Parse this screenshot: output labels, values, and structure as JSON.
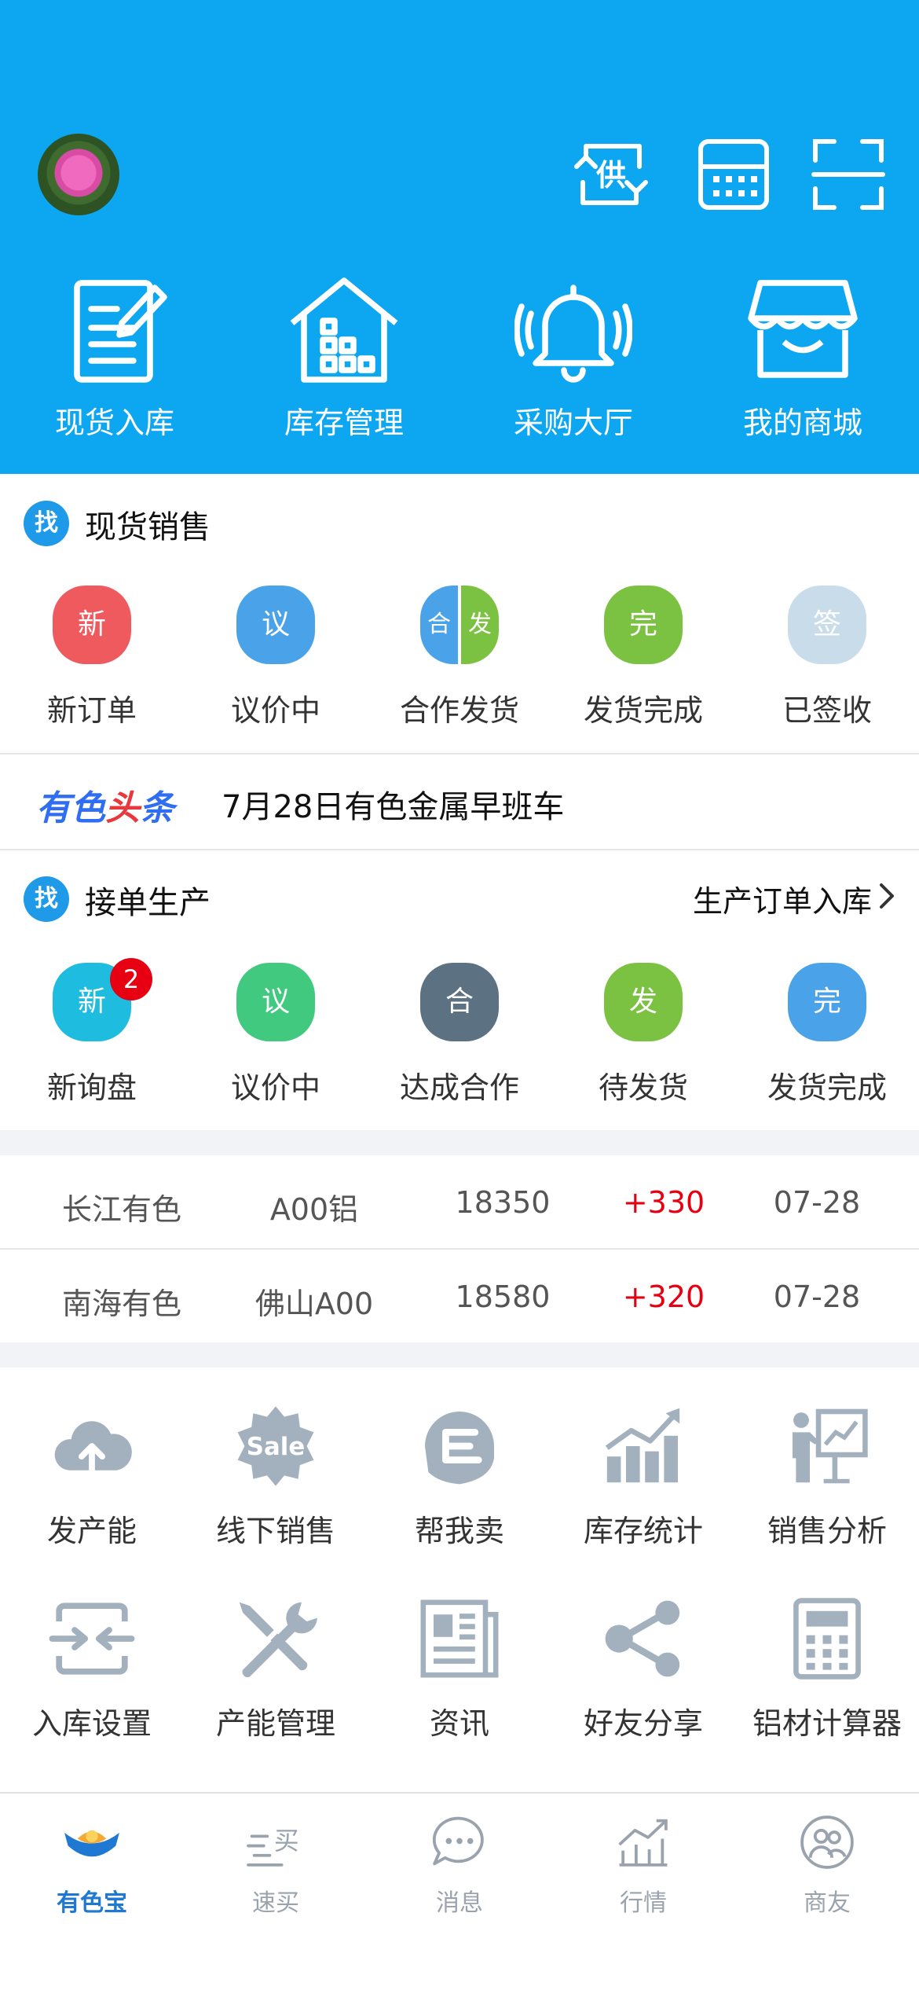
{
  "header": {
    "icons": [
      {
        "name": "supply-switch-icon",
        "text": "供"
      },
      {
        "name": "calculator-icon"
      },
      {
        "name": "scan-icon"
      }
    ],
    "nav": [
      {
        "label": "现货入库",
        "icon": "notepad-icon"
      },
      {
        "label": "库存管理",
        "icon": "warehouse-icon"
      },
      {
        "label": "采购大厅",
        "icon": "bell-icon"
      },
      {
        "label": "我的商城",
        "icon": "shop-icon"
      }
    ]
  },
  "spot_sales": {
    "badge": "找",
    "title": "现货销售",
    "items": [
      {
        "label": "新订单",
        "glyph": "新",
        "color": "#ef5a5f"
      },
      {
        "label": "议价中",
        "glyph": "议",
        "color": "#4aa3e8"
      },
      {
        "label": "合作发货",
        "glyph_left": "合",
        "glyph_right": "发",
        "color_left": "#4aa3e8",
        "color_right": "#7cc242"
      },
      {
        "label": "发货完成",
        "glyph": "完",
        "color": "#7cc242"
      },
      {
        "label": "已签收",
        "glyph": "签",
        "color": "#c9dcea"
      }
    ]
  },
  "news": {
    "logo_part1": "有色",
    "logo_part2": "头",
    "logo_part3": "条",
    "headline": "7月28日有色金属早班车"
  },
  "production": {
    "badge": "找",
    "title": "接单生产",
    "link": "生产订单入库",
    "items": [
      {
        "label": "新询盘",
        "glyph": "新",
        "color": "#1ebde0",
        "count": "2"
      },
      {
        "label": "议价中",
        "glyph": "议",
        "color": "#41c97f"
      },
      {
        "label": "达成合作",
        "glyph": "合",
        "color": "#5c7283"
      },
      {
        "label": "待发货",
        "glyph": "发",
        "color": "#7cc242"
      },
      {
        "label": "发货完成",
        "glyph": "完",
        "color": "#4aa3e8"
      }
    ]
  },
  "prices": [
    {
      "market": "长江有色",
      "product": "A00铝",
      "price": "18350",
      "change": "+330",
      "date": "07-28"
    },
    {
      "market": "南海有色",
      "product": "佛山A00",
      "price": "18580",
      "change": "+320",
      "date": "07-28"
    }
  ],
  "tools": [
    {
      "label": "发产能",
      "icon": "cloud-upload-icon"
    },
    {
      "label": "线下销售",
      "icon": "sale-badge-icon",
      "icon_text": "Sale"
    },
    {
      "label": "帮我卖",
      "icon": "hand-e-icon"
    },
    {
      "label": "库存统计",
      "icon": "bar-chart-icon"
    },
    {
      "label": "销售分析",
      "icon": "presenter-chart-icon"
    },
    {
      "label": "入库设置",
      "icon": "inbound-arrows-icon"
    },
    {
      "label": "产能管理",
      "icon": "tools-icon"
    },
    {
      "label": "资讯",
      "icon": "newspaper-icon"
    },
    {
      "label": "好友分享",
      "icon": "share-icon"
    },
    {
      "label": "铝材计算器",
      "icon": "calculator-icon"
    }
  ],
  "tabbar": [
    {
      "label": "有色宝",
      "icon": "handshake-icon",
      "active": true
    },
    {
      "label": "速买",
      "icon": "quick-buy-icon",
      "icon_text": "买"
    },
    {
      "label": "消息",
      "icon": "message-icon"
    },
    {
      "label": "行情",
      "icon": "market-trend-icon"
    },
    {
      "label": "商友",
      "icon": "friends-icon"
    }
  ],
  "colors": {
    "header_bg": "#0ca6f1",
    "accent_blue": "#1e9ae8",
    "price_up": "#e60012",
    "icon_gray": "#a3b1be",
    "tab_active": "#1f78d1"
  }
}
